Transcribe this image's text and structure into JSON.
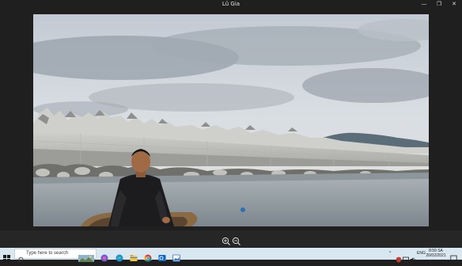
{
  "window": {
    "title": "Lũ Gia",
    "controls": {
      "minimize": "—",
      "maximize": "❐",
      "close": "✕"
    }
  },
  "viewer": {
    "image_subject": "man-on-boat-breakwater-sea"
  },
  "zoom": {
    "zoom_in_icon": "zoom-in-icon",
    "zoom_out_icon": "zoom-out-icon"
  },
  "taskbar": {
    "search_placeholder": "Type here to search",
    "apps": [
      "copilot-icon",
      "edge-icon",
      "file-explorer-icon",
      "chrome-icon",
      "outlook-icon",
      "photos-icon"
    ],
    "tray": {
      "chevron": "^",
      "language": "ENG",
      "time": "8:59 SA",
      "date": "26/02/2021"
    }
  },
  "colors": {
    "titlebar_bg": "#1f1f1f",
    "taskbar_bg": "#d9e7f0",
    "accent": "#3c78c8"
  }
}
